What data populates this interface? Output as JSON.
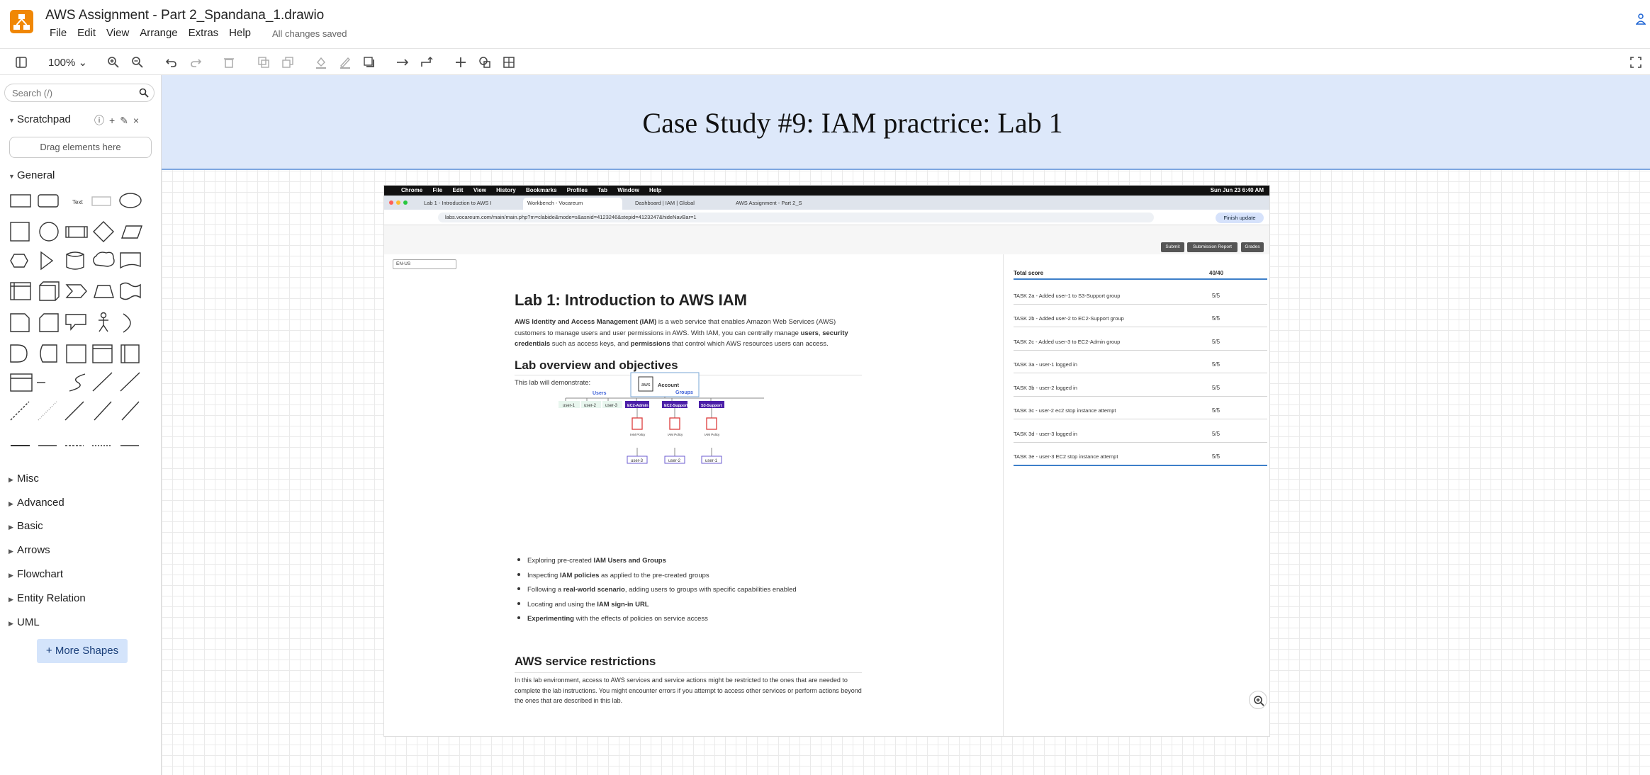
{
  "app": {
    "title": "AWS Assignment - Part 2_Spandana_1.drawio",
    "status": "All changes saved",
    "menu": [
      "File",
      "Edit",
      "View",
      "Arrange",
      "Extras",
      "Help"
    ]
  },
  "toolbar": {
    "zoom": "100%",
    "icons": [
      "format-panel-icon",
      "zoom-in-icon",
      "zoom-out-icon",
      "undo-icon",
      "redo-icon",
      "delete-icon",
      "to-front-icon",
      "to-back-icon",
      "fill-color-icon",
      "line-color-icon",
      "shadow-icon",
      "connection-icon",
      "waypoints-icon",
      "insert-icon",
      "shapes-icon",
      "table-icon",
      "fullscreen-icon"
    ]
  },
  "sidebar": {
    "search_placeholder": "Search (/)",
    "scratchpad_label": "Scratchpad",
    "drag_here": "Drag elements here",
    "general_label": "General",
    "libraries": [
      "Misc",
      "Advanced",
      "Basic",
      "Arrows",
      "Flowchart",
      "Entity Relation",
      "UML"
    ],
    "more_shapes": "+ More Shapes"
  },
  "canvas": {
    "heading": "Case Study #9: IAM practrice: Lab 1",
    "screenshot": {
      "mac_menu": [
        "Chrome",
        "File",
        "Edit",
        "View",
        "History",
        "Bookmarks",
        "Profiles",
        "Tab",
        "Window",
        "Help"
      ],
      "clock": "Sun Jun 23  6:40 AM",
      "tabs": [
        "Lab 1 - Introduction to AWS I",
        "Workbench - Vocareum",
        "Dashboard | IAM | Global",
        "AWS Assignment - Part 2_S"
      ],
      "url": "labs.vocareum.com/main/main.php?m=clabide&mode=s&asnid=4123246&stepid=4123247&hideNavBar=1",
      "finish_update": "Finish update",
      "buttons": [
        "Submit",
        "Submission Report",
        "Grades"
      ],
      "region": "EN-US",
      "lab_title": "Lab 1: Introduction to AWS IAM",
      "intro_parts": [
        "AWS Identity and Access Management (IAM)",
        " is a web service that enables Amazon Web Services (AWS) customers to manage users and user permissions in AWS. With IAM, you can centrally manage ",
        "users",
        ", ",
        "security credentials",
        " such as access keys, and ",
        "permissions",
        " that control which AWS resources users can access."
      ],
      "overview_heading": "Lab overview and objectives",
      "overview_text": "This lab will demonstrate:",
      "diagram": {
        "account": "Account",
        "users_label": "Users",
        "groups_label": "Groups",
        "users": [
          "user-1",
          "user-2",
          "user-3"
        ],
        "groups": [
          "EC2-Admin",
          "EC2-Support",
          "S3-Support"
        ],
        "policy_label": "IAM Policy",
        "bottom_users": [
          "user-3",
          "user-2",
          "user-1"
        ]
      },
      "bullets": [
        {
          "pre": "Exploring pre-created ",
          "bold": "IAM Users and Groups",
          "post": ""
        },
        {
          "pre": "Inspecting ",
          "bold": "IAM policies",
          "post": " as applied to the pre-created groups"
        },
        {
          "pre": "Following a ",
          "bold": "real-world scenario",
          "post": ", adding users to groups with specific capabilities enabled"
        },
        {
          "pre": "Locating and using the ",
          "bold": "IAM sign-in URL",
          "post": ""
        },
        {
          "pre": "",
          "bold": "Experimenting",
          "post": " with the effects of policies on service access"
        }
      ],
      "restrictions_heading": "AWS service restrictions",
      "restrictions_text": "In this lab environment, access to AWS services and service actions might be restricted to the ones that are needed to complete the lab instructions. You might encounter errors if you attempt to access other services or perform actions beyond the ones that are described in this lab.",
      "scores": {
        "total_label": "Total score",
        "total": "40/40",
        "rows": [
          {
            "task": "TASK 2a - Added user-1 to S3-Support group",
            "score": "5/5"
          },
          {
            "task": "TASK 2b - Added user-2 to EC2-Support group",
            "score": "5/5"
          },
          {
            "task": "TASK 2c - Added user-3 to EC2-Admin group",
            "score": "5/5"
          },
          {
            "task": "TASK 3a - user-1 logged in",
            "score": "5/5"
          },
          {
            "task": "TASK 3b - user-2 logged in",
            "score": "5/5"
          },
          {
            "task": "TASK 3c - user-2 ec2 stop instance attempt",
            "score": "5/5"
          },
          {
            "task": "TASK 3d - user-3 logged in",
            "score": "5/5"
          },
          {
            "task": "TASK 3e - user-3 EC2 stop instance attempt",
            "score": "5/5"
          }
        ]
      }
    }
  },
  "colors": {
    "brand": "#f08705",
    "heading_band": "#dde8fa",
    "heading_border": "#7ea6e0",
    "group_fill": "#4b1fa8",
    "policy_red": "#dd3b3b",
    "more_shapes_bg": "#d4e4fb"
  }
}
